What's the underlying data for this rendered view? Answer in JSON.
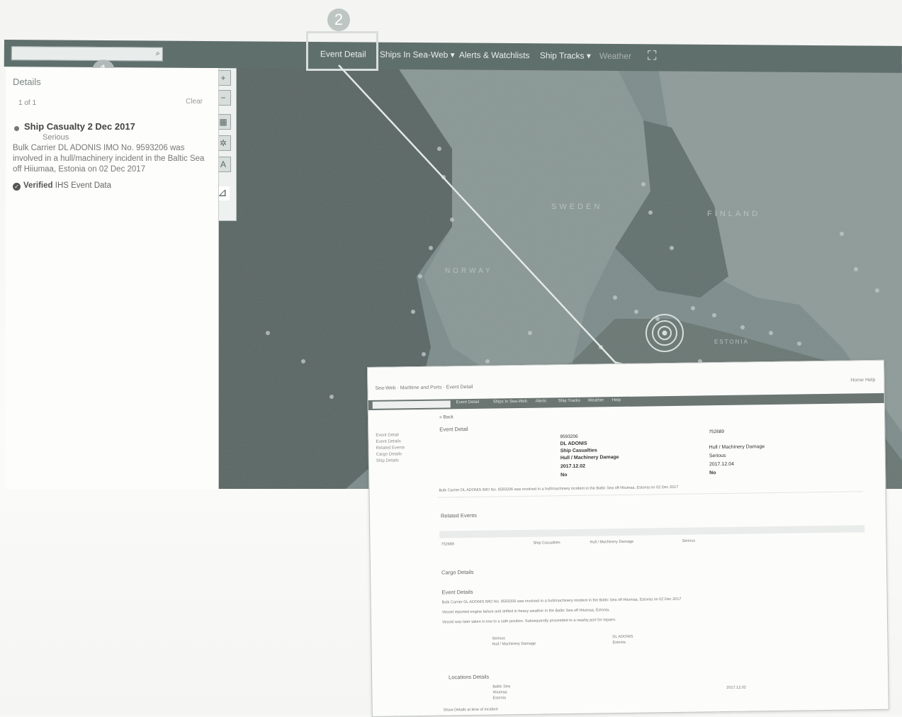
{
  "topbar": {
    "nav": [
      {
        "label": "Event Detail",
        "dim": false
      },
      {
        "label": "Ships In Sea-Web ▾",
        "dim": false
      },
      {
        "label": "Alerts & Watchlists",
        "dim": false
      },
      {
        "label": "Ship Tracks ▾",
        "dim": false
      },
      {
        "label": "Weather",
        "dim": true
      }
    ]
  },
  "callouts": {
    "one": "1",
    "two": "2"
  },
  "details": {
    "header": "Details",
    "count": "1 of 1",
    "clear": "Clear",
    "event_title": "Ship Casualty 2 Dec 2017",
    "severity": "Serious",
    "description": "Bulk Carrier DL ADONIS IMO No. 9593206 was involved in a hull/machinery incident in the Baltic Sea off Hiiumaa, Estonia on 02 Dec 2017",
    "verified_label": "Verified",
    "verified_source": "IHS Event Data"
  },
  "map": {
    "labels": [
      "SWEDEN",
      "FINLAND",
      "NORWAY",
      "ESTONIA"
    ]
  },
  "inset": {
    "browser_title": "Sea-Web · Maritime and Ports · Event Detail",
    "browser_right": "Home   Help",
    "nav": [
      "Event Detail",
      "Ships In Sea-Web",
      "Alerts",
      "Ship Tracks",
      "Weather",
      "Help"
    ],
    "back": "« Back",
    "event_detail_heading": "Event Detail",
    "side_links": [
      "Event Detail",
      "Event Details",
      "Related Events",
      "Cargo Details",
      "Ship Details"
    ],
    "left_values": [
      "9593206",
      "DL ADONIS",
      "Ship Casualties",
      "Hull / Machinery Damage",
      "2017.12.02",
      "No"
    ],
    "right_values": [
      "752689",
      "Hull / Machinery Damage",
      "Serious",
      "2017.12.04",
      "No"
    ],
    "summary_line": "Bulk Carrier DL ADONIS IMO No. 9593206 was involved in a hull/machinery incident in the Baltic Sea off Hiiumaa, Estonia on 02 Dec 2017",
    "related_heading": "Related Events",
    "related_row": [
      "752689",
      "Ship Casualties",
      "Hull / Machinery Damage",
      "Serious"
    ],
    "cargo_heading": "Cargo Details",
    "event_details_heading": "Event Details",
    "event_lines": [
      "Bulk Carrier DL ADONIS IMO No. 9593206 was involved in a hull/machinery incident in the Baltic Sea off Hiiumaa, Estonia on 02 Dec 2017",
      "Vessel reported engine failure and drifted in heavy weather in the Baltic Sea off Hiiumaa, Estonia.",
      "Vessel was later taken in tow to a safe position. Subsequently proceeded to a nearby port for repairs."
    ],
    "event_detail_values": [
      "Serious",
      "Hull / Machinery Damage",
      "DL ADONIS",
      "Estonia"
    ],
    "locations_heading": "Locations Details",
    "locations_values": [
      "Baltic Sea",
      "Hiiumaa",
      "Estonia",
      "2017.12.02"
    ],
    "footer": "Show Details at time of Incident"
  }
}
